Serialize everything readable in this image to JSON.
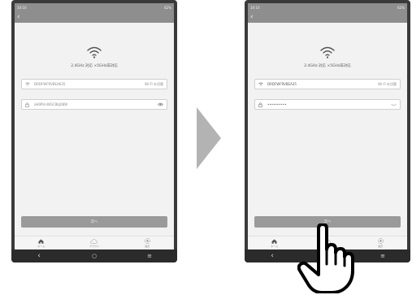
{
  "status_bar": {
    "time": "10:10",
    "battery_text": "62%"
  },
  "app": {
    "title": "",
    "band_info": "2.4GHz 対応 ×5GHz非対応"
  },
  "left_screen": {
    "ssid_value": "DRDFWFRVBEAK35",
    "wifi_switch_label": "Wi-Fi を切替",
    "password_value": "aH0PUnWGC8bJX8W",
    "connect_label": "次へ"
  },
  "right_screen": {
    "ssid_value": "DRDFWFRVBEA35",
    "wifi_switch_label": "Wi-Fi を切替",
    "password_value": "••••••••••",
    "connect_label": "次へ"
  },
  "tabs": [
    {
      "label": "ホーム",
      "icon": "home-icon"
    },
    {
      "label": "クラウド",
      "icon": "cloud-icon"
    },
    {
      "label": "設定",
      "icon": "settings-icon"
    }
  ],
  "nav": {
    "back": "‹",
    "home": "○",
    "recent": "≡"
  },
  "colors": {
    "header_gray": "#8e8e8e",
    "button_gray": "#9a9a9a",
    "bezel": "#3a3a3a"
  }
}
